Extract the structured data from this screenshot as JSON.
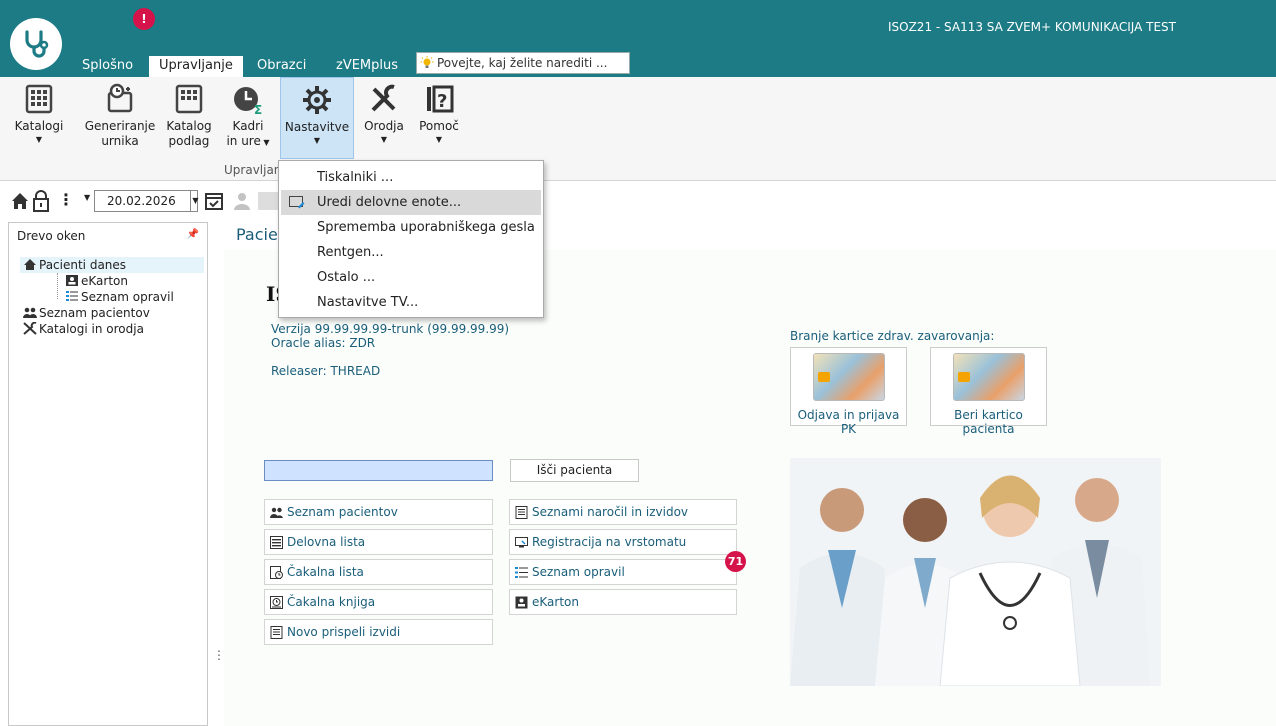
{
  "window": {
    "title": "ISOZ21 - SA113 SA ZVEM+ KOMUNIKACIJA TEST",
    "tab_badge": "!"
  },
  "tabs": [
    {
      "label": "Splošno"
    },
    {
      "label": "Upravljanje",
      "active": true
    },
    {
      "label": "Obrazci"
    },
    {
      "label": "zVEMplus"
    }
  ],
  "tell_me": {
    "placeholder": "Povejte, kaj želite narediti ..."
  },
  "ribbon": {
    "buttons": [
      {
        "line1": "Katalogi",
        "line2": ""
      },
      {
        "line1": "Generiranje",
        "line2": "urnika"
      },
      {
        "line1": "Katalog",
        "line2": "podlag"
      },
      {
        "line1": "Kadri",
        "line2": "in ure"
      },
      {
        "line1": "Nastavitve",
        "line2": ""
      },
      {
        "line1": "Orodja",
        "line2": ""
      },
      {
        "line1": "Pomoč",
        "line2": ""
      }
    ],
    "group_label": "Upravljanje"
  },
  "menu": {
    "items": [
      {
        "label": "Tiskalniki ..."
      },
      {
        "label": "Uredi delovne enote..."
      },
      {
        "label": "Sprememba uporabniškega gesla"
      },
      {
        "label": "Rentgen..."
      },
      {
        "label": "Ostalo ..."
      },
      {
        "label": "Nastavitve TV..."
      }
    ]
  },
  "toolbar": {
    "date": "20.02.2026"
  },
  "left_panel": {
    "title": "Drevo oken",
    "items": [
      {
        "label": "Pacienti danes"
      },
      {
        "label": "eKarton"
      },
      {
        "label": "Seznam opravil"
      },
      {
        "label": "Seznam pacientov"
      },
      {
        "label": "Katalogi in orodja"
      }
    ]
  },
  "main": {
    "tab_title": "Pacien",
    "app_title": "IS",
    "version": "Verzija 99.99.99.99-trunk  (99.99.99.99)",
    "oracle": "Oracle alias: ZDR",
    "releaser": "Releaser: THREAD",
    "search_value": "",
    "search_button": "Išči pacienta",
    "left_buttons": [
      {
        "label": "Seznam pacientov",
        "icon": "people-icon"
      },
      {
        "label": "Delovna lista",
        "icon": "list-icon"
      },
      {
        "label": "Čakalna lista",
        "icon": "clock-list-icon"
      },
      {
        "label": "Čakalna knjiga",
        "icon": "clock-book-icon"
      },
      {
        "label": "Novo prispeli izvidi",
        "icon": "document-icon"
      }
    ],
    "right_buttons": [
      {
        "label": "Seznami naročil in izvidov",
        "icon": "document-icon"
      },
      {
        "label": "Registracija na vrstomatu",
        "icon": "kiosk-icon"
      },
      {
        "label": "Seznam opravil",
        "icon": "checklist-icon"
      },
      {
        "label": "eKarton",
        "icon": "contact-card-icon"
      }
    ],
    "notification_count": "71",
    "card_section_label": "Branje kartice zdrav. zavarovanja:",
    "cards": [
      {
        "label": "Odjava in prijava PK"
      },
      {
        "label": "Beri kartico pacienta"
      }
    ]
  },
  "colors": {
    "titlebar": "#1c7b85",
    "accent_badge": "#d6124a",
    "link_text": "#1a5e7a",
    "ribbon_selected": "#cde4f7"
  }
}
